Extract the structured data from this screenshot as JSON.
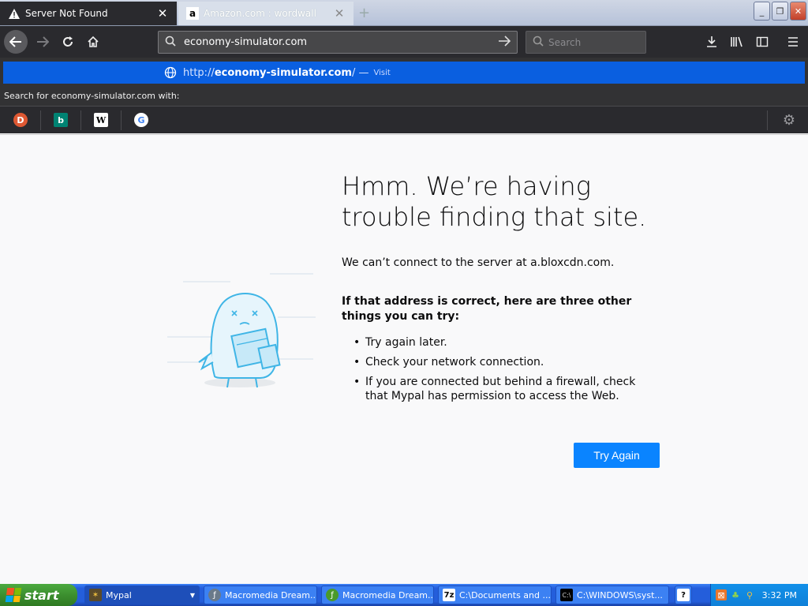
{
  "tabs": [
    {
      "title": "Server Not Found",
      "active": true,
      "icon": "warning-icon"
    },
    {
      "title": "Amazon.com : wordwall",
      "active": false,
      "icon": "amazon-icon"
    }
  ],
  "new_tab_glyph": "+",
  "window_controls": {
    "minimize": "_",
    "restore": "❐",
    "close": "✕"
  },
  "navbar": {
    "url": "economy-simulator.com",
    "search_placeholder": "Search"
  },
  "suggestion": {
    "url_prefix": "http://",
    "url_domain": "economy-simulator.com",
    "url_suffix": "/ —",
    "action": "Visit"
  },
  "search_with_label": "Search for economy-simulator.com with:",
  "search_engines": [
    "DuckDuckGo",
    "Bing",
    "Wikipedia",
    "Google"
  ],
  "error_page": {
    "title": "Hmm. We’re having trouble finding that site.",
    "description": "We can’t connect to the server at a.bloxcdn.com.",
    "subtitle": "If that address is correct, here are three other things you can try:",
    "suggestions": [
      "Try again later.",
      "Check your network connection.",
      "If you are connected but behind a firewall, check that Mypal has permission to access the Web."
    ],
    "button_label": "Try Again"
  },
  "taskbar": {
    "start_label": "start",
    "tasks": [
      {
        "label": "Mypal",
        "active": true
      },
      {
        "label": "Macromedia Dream...",
        "active": false
      },
      {
        "label": "Macromedia Dream...",
        "active": false
      },
      {
        "label": "C:\\Documents and ...",
        "active": false
      },
      {
        "label": "C:\\WINDOWS\\syst...",
        "active": false
      }
    ],
    "clock": "3:32 PM"
  },
  "colors": {
    "accent": "#0a84ff",
    "suggestion_highlight": "#0a5fe0",
    "chrome_dark": "#2a2a2e"
  }
}
